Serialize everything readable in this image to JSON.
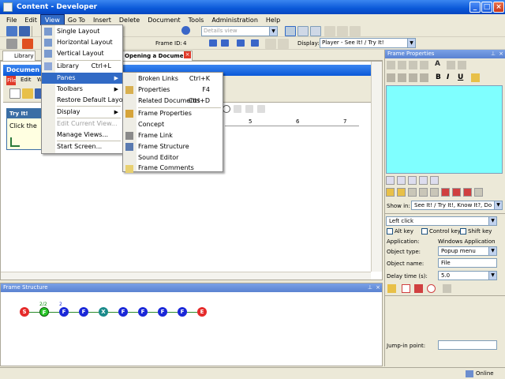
{
  "window": {
    "title": "Content - Developer"
  },
  "menubar": [
    "File",
    "Edit",
    "View",
    "Go To",
    "Insert",
    "Delete",
    "Document",
    "Tools",
    "Administration",
    "Help"
  ],
  "toolbar": {
    "details_view": "Details view",
    "frame_id_label": "Frame ID:",
    "frame_id_value": "4",
    "display_label": "Display:",
    "display_value": "Player - See It! / Try It!"
  },
  "left_tabs": {
    "library": "Library",
    "document_tab": "Opening a Document"
  },
  "doc_window": {
    "title": "Documen",
    "menu_file": "File",
    "menu_edit": "Edit",
    "menu_w": "W"
  },
  "tryit": {
    "title": "Try It!",
    "text": "Click the "
  },
  "ruler": [
    "5",
    "6",
    "7"
  ],
  "view_menu": {
    "items": [
      {
        "label": "Single Layout"
      },
      {
        "label": "Horizontal Layout"
      },
      {
        "label": "Vertical Layout"
      },
      {
        "label": "Library",
        "shortcut": "Ctrl+L"
      },
      {
        "label": "Panes"
      },
      {
        "label": "Toolbars"
      },
      {
        "label": "Restore Default Layout"
      },
      {
        "label": "Display"
      },
      {
        "label": "Edit Current View..."
      },
      {
        "label": "Manage Views..."
      },
      {
        "label": "Start Screen..."
      }
    ]
  },
  "panes_menu": {
    "items": [
      {
        "label": "Broken Links",
        "shortcut": "Ctrl+K"
      },
      {
        "label": "Properties",
        "shortcut": "F4"
      },
      {
        "label": "Related Documents",
        "shortcut": "Ctrl+D"
      },
      {
        "label": "Frame Properties"
      },
      {
        "label": "Concept"
      },
      {
        "label": "Frame Link"
      },
      {
        "label": "Frame Structure"
      },
      {
        "label": "Sound Editor"
      },
      {
        "label": "Frame Comments"
      }
    ]
  },
  "frame_structure": {
    "title": "Frame Structure",
    "nodes": [
      "S",
      "F",
      "F",
      "F",
      "X",
      "F",
      "F",
      "F",
      "F",
      "E"
    ],
    "label_a": "2/2",
    "label_b": "2"
  },
  "frame_properties": {
    "title": "Frame Properties",
    "show_in_label": "Show in:",
    "show_in_value": "See It! / Try It!, Know It?, Do It!",
    "action_value": "Left click",
    "alt_key": "Alt key",
    "control_key": "Control key",
    "shift_key": "Shift key",
    "application_label": "Application:",
    "application_value": "Windows Application",
    "object_type_label": "Object type:",
    "object_type_value": "Popup menu",
    "object_name_label": "Object name:",
    "object_name_value": "File",
    "delay_label": "Delay time (s):",
    "delay_value": "5.0",
    "jumpin_label": "Jump-in point:"
  },
  "statusbar": {
    "status": "Online"
  },
  "colors": {
    "highlight": "#316ac5",
    "title_blue": "#0a58d8",
    "cyan_preview": "#7fffff"
  }
}
